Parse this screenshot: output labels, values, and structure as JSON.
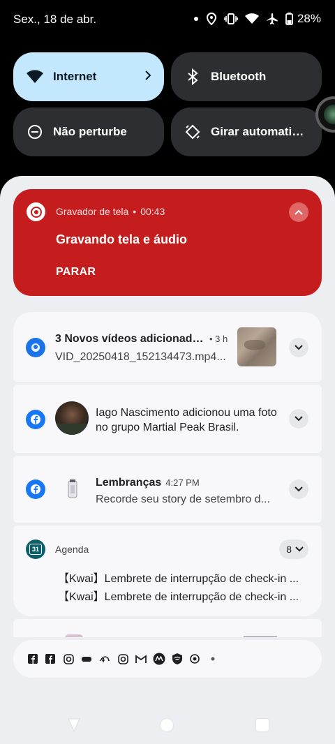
{
  "status_bar": {
    "date": "Sex., 18 de abr.",
    "battery": "28%",
    "icons": [
      "dot-icon",
      "location-icon",
      "vibrate-icon",
      "wifi-icon",
      "airplane-icon",
      "battery-icon"
    ]
  },
  "quick_tiles": [
    {
      "label": "Internet",
      "icon": "wifi-icon",
      "active": true
    },
    {
      "label": "Bluetooth",
      "icon": "bluetooth-icon",
      "active": false
    },
    {
      "label": "Não perturbe",
      "icon": "do-not-disturb-icon",
      "active": false
    },
    {
      "label": "Girar automatica..",
      "icon": "auto-rotate-icon",
      "active": false
    }
  ],
  "recorder": {
    "app": "Gravador de tela",
    "separator": "•",
    "time": "00:43",
    "title": "Gravando tela e áudio",
    "action": "PARAR",
    "color": "#c51d1d"
  },
  "notifications": [
    {
      "title": "3 Novos vídeos adicionado..",
      "time": "• 3 h",
      "text": "VID_20250418_152134473.mp4..."
    },
    {
      "text": "Iago Nascimento adicionou uma foto no grupo Martial Peak Brasil."
    },
    {
      "title": "Lembranças",
      "time": "4:27 PM",
      "text": "Recorde seu story de setembro d..."
    },
    {
      "app": "Agenda",
      "count": "8",
      "badge_text": "31",
      "lines": [
        "【Kwai】Lembrete de interrupção de check-in ...",
        "【Kwai】Lembrete de interrupção de check-in ..."
      ]
    }
  ],
  "overflow_icons": [
    "facebook-square-icon",
    "facebook-icon",
    "instagram-icon",
    "kwai-icon",
    "disney-plus-icon",
    "instagram-icon",
    "gmail-icon",
    "motorola-icon",
    "shield-icon",
    "record-icon",
    "more-dot-icon"
  ]
}
